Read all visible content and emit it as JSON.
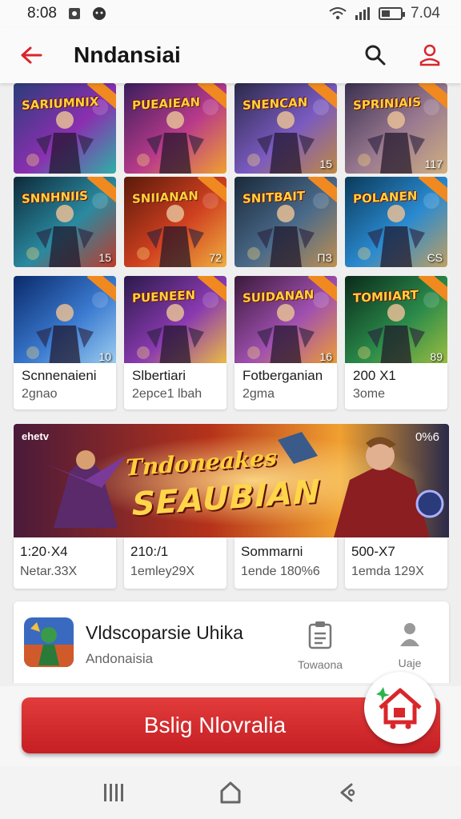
{
  "status": {
    "time": "8:08",
    "battery_text": "7.04",
    "battery_level": 0.45
  },
  "header": {
    "title": "Nndansiai"
  },
  "grid": {
    "rows": [
      [
        {
          "title": "SARIUMNIX",
          "num": "",
          "colors": [
            "#2b3d7a",
            "#8a2fb0",
            "#2fb0a6"
          ]
        },
        {
          "title": "PUEAIEAN",
          "num": "",
          "colors": [
            "#3a1e5c",
            "#b83a8a",
            "#f0a030"
          ]
        },
        {
          "title": "SNENCAN",
          "num": "15",
          "colors": [
            "#2a2a4a",
            "#7a5ac0",
            "#c08a40"
          ]
        },
        {
          "title": "SPRINIAIS",
          "num": "117",
          "colors": [
            "#3a3050",
            "#9a7a90",
            "#d0b080"
          ]
        }
      ],
      [
        {
          "title": "SNNHNIIS",
          "num": "15",
          "colors": [
            "#0e2a3a",
            "#2a8aa0",
            "#c03a2a"
          ]
        },
        {
          "title": "SNIIANAN",
          "num": "72",
          "colors": [
            "#5a1a0a",
            "#d04020",
            "#f0b040"
          ]
        },
        {
          "title": "SNITBAIT",
          "num": "ΠЗ",
          "colors": [
            "#1a2a3a",
            "#4a6a8a",
            "#c09050"
          ]
        },
        {
          "title": "POLANEN",
          "num": "ЄS",
          "colors": [
            "#0a3a5a",
            "#2a8ad0",
            "#c0a060"
          ]
        }
      ],
      [
        {
          "title": "",
          "num": "10",
          "colors": [
            "#0a2a6a",
            "#3a7ad0",
            "#a0d0f0"
          ]
        },
        {
          "title": "PUENEEN",
          "num": "",
          "colors": [
            "#2a1a4a",
            "#8a3ab0",
            "#f0c040"
          ]
        },
        {
          "title": "SUIDANAN",
          "num": "16",
          "colors": [
            "#3a1a3a",
            "#a050b0",
            "#f0a030"
          ]
        },
        {
          "title": "TOMIIART",
          "num": "89",
          "colors": [
            "#0a2a1a",
            "#2a8a4a",
            "#a0c040"
          ]
        }
      ]
    ]
  },
  "captions": [
    {
      "title": "Scnnenaieni",
      "sub": "2gnao"
    },
    {
      "title": "Slbertiari",
      "sub": "2epce1 lbah"
    },
    {
      "title": "Fotberganian",
      "sub": "2gma"
    },
    {
      "title": "200 X1",
      "sub": "3ome"
    }
  ],
  "banner": {
    "tag": "ehetv",
    "count": "0%6",
    "line1": "Tndoneakes",
    "line2": "SEAUBIAN"
  },
  "stats": [
    {
      "top": "1:20·X4",
      "bottom": "Netar.33X"
    },
    {
      "top": "210:/1",
      "bottom": "1emley29X"
    },
    {
      "top": "Sommarni",
      "bottom": "1ende 180%6"
    },
    {
      "top": "500-X7",
      "bottom": "1emda 129X"
    }
  ],
  "app_card": {
    "name": "Vldscoparsie Uhika",
    "sub": "Andonaisia",
    "action1_label": "Towaona",
    "action2_label": "Uaje"
  },
  "cta": {
    "label": "Bslig Nlovralia"
  },
  "colors": {
    "accent": "#d9262b",
    "background": "#efefef"
  }
}
